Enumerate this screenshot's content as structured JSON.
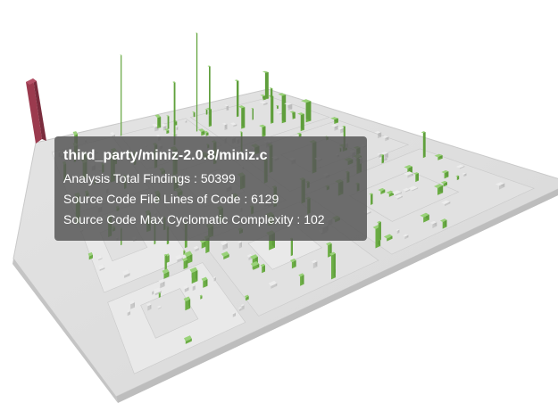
{
  "scene": {
    "view": "3D code city",
    "floor_color": "#dedede",
    "building_color": "#d0d0d0",
    "highlight_color": "#7fbf56",
    "selected_color": "#9b3a4e"
  },
  "tooltip": {
    "title": "third_party/miniz-2.0.8/miniz.c",
    "rows": [
      {
        "label": "Analysis Total Findings",
        "value": "50399",
        "text": "Analysis Total Findings : 50399"
      },
      {
        "label": "Source Code File Lines of Code",
        "value": "6129",
        "text": "Source Code File Lines of Code : 6129"
      },
      {
        "label": "Source Code Max Cyclomatic Complexity",
        "value": "102",
        "text": "Source Code Max Cyclomatic Complexity : 102"
      }
    ]
  }
}
